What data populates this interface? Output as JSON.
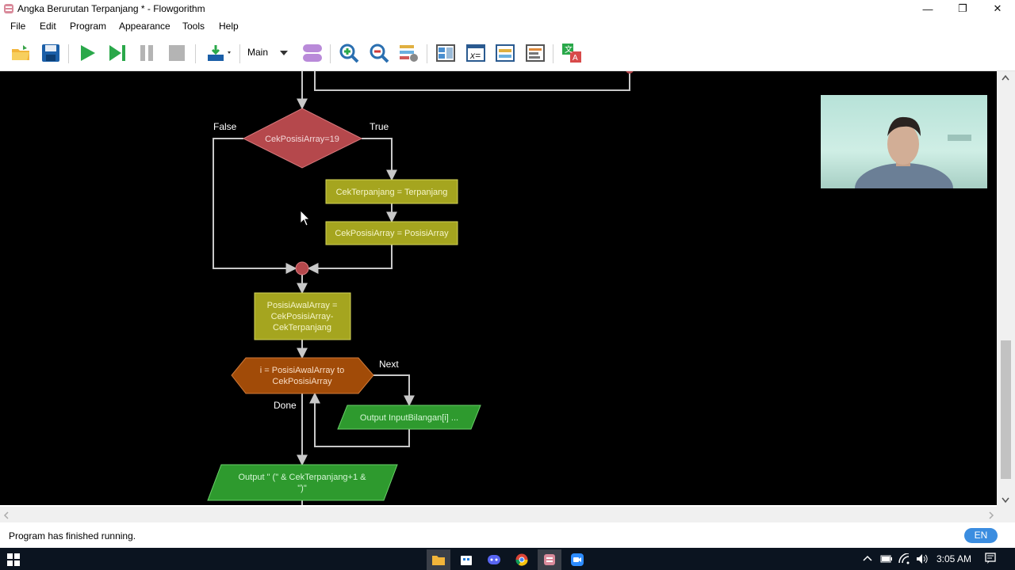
{
  "window": {
    "title": "Angka Berurutan Terpanjang * - Flowgorithm",
    "minimize_glyph": "—",
    "restore_glyph": "❐",
    "close_glyph": "✕"
  },
  "menu": [
    "File",
    "Edit",
    "Program",
    "Appearance",
    "Tools",
    "Help"
  ],
  "toolbar": {
    "function_select": "Main",
    "icons": [
      "open-folder-icon",
      "save-icon",
      "run-icon",
      "step-icon",
      "pause-icon",
      "stop-icon",
      "layout-run-icon",
      "shape-icon",
      "zoom-in-icon",
      "zoom-out-icon",
      "layout-options-icon",
      "view-layout-icon",
      "variable-watch-icon",
      "console-icon",
      "source-code-icon",
      "translate-icon"
    ]
  },
  "flowchart": {
    "decision": {
      "label": "CekPosisiArray=19",
      "false_label": "False",
      "true_label": "True"
    },
    "assign1": "CekTerpanjang = Terpanjang",
    "assign2": "CekPosisiArray = PosisiArray",
    "assign3": {
      "line1": "PosisiAwalArray =",
      "line2": "CekPosisiArray-",
      "line3": "CekTerpanjang"
    },
    "for_loop": {
      "line1": "i = PosisiAwalArray to",
      "line2": "CekPosisiArray",
      "next_label": "Next",
      "done_label": "Done"
    },
    "output1": "Output InputBilangan[i] ...",
    "output2": {
      "line1": "Output \" (\" & CekTerpanjang+1 &",
      "line2": "\")\""
    },
    "colors": {
      "decision": "#b5484c",
      "assign": "#a5a51f",
      "loop": "#a14b08",
      "output": "#2e9a2e",
      "connector": "#b5484c",
      "line": "#c8c8c8"
    }
  },
  "status": {
    "message": "Program has finished running.",
    "language": "EN"
  },
  "taskbar": {
    "time": "3:05 AM",
    "apps": [
      "file-explorer-icon",
      "store-icon",
      "discord-icon",
      "chrome-icon",
      "flowgorithm-icon",
      "zoom-icon"
    ]
  }
}
